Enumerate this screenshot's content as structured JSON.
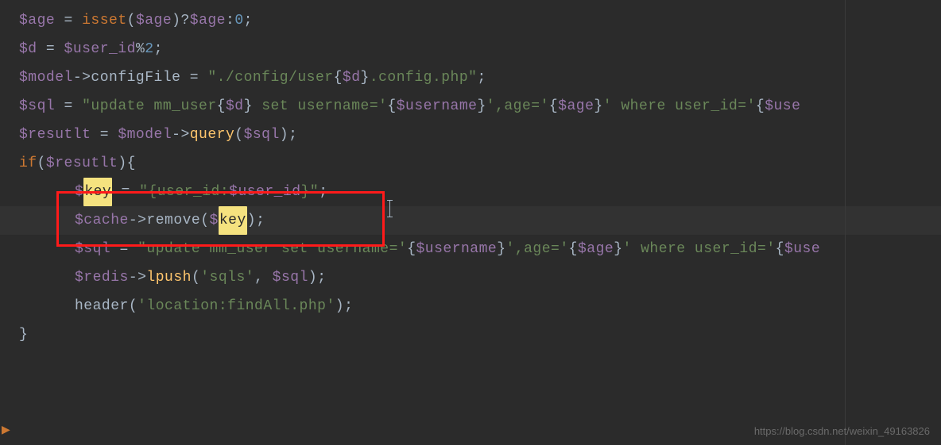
{
  "code": {
    "l1": {
      "v1": "$age",
      "eq": " = ",
      "kw": "isset",
      "p1": "(",
      "v2": "$age",
      "p2": ")?",
      "v3": "$age",
      "p3": ":",
      "n": "0",
      "end": ";"
    },
    "l2": {
      "v1": "$d",
      "eq": " = ",
      "v2": "$user_id",
      "op": "%",
      "n": "2",
      "end": ";"
    },
    "l3": {
      "v1": "$model",
      "arrow": "->",
      "prop": "configFile",
      "eq": " = ",
      "s1": "\"./config/user",
      "b1": "{",
      "v2": "$d",
      "b2": "}",
      "s2": ".config.php\"",
      "end": ";"
    },
    "l4": {
      "v1": "$sql",
      "eq": " = ",
      "s1": "\"update mm_user",
      "b1": "{",
      "v2": "$d",
      "b2": "}",
      "s2": " set username='",
      "b3": "{",
      "v3": "$username",
      "b4": "}",
      "s3": "',age='",
      "b5": "{",
      "v4": "$age",
      "b6": "}",
      "s4": "' where user_id='",
      "b7": "{",
      "v5": "$use"
    },
    "l5": {
      "v1": "$resutlt",
      "eq": " = ",
      "v2": "$model",
      "arrow": "->",
      "fn": "query",
      "p1": "(",
      "v3": "$sql",
      "p2": ")",
      "end": ";"
    },
    "l6": {
      "kw": "if",
      "p1": "(",
      "v1": "$resutlt",
      "p2": "){"
    },
    "l7": {
      "dol": "$",
      "hl": "key",
      "eq": " = ",
      "s1": "\"{user_id:",
      "v1": "$user_id",
      "s2": "}\"",
      "end": ";"
    },
    "l8": {
      "v1": "$cache",
      "arrow": "->",
      "fn": "remove",
      "p1": "(",
      "dol": "$",
      "hl": "key",
      "p2": ")",
      "end": ";"
    },
    "l9": {
      "v1": "$sql",
      "eq": " = ",
      "s1": "\"update mm_user set username='",
      "b1": "{",
      "v2": "$username",
      "b2": "}",
      "s2": "',age='",
      "b3": "{",
      "v3": "$age",
      "b4": "}",
      "s3": "' where user_id='",
      "b5": "{",
      "v4": "$use"
    },
    "l10": {
      "v1": "$redis",
      "arrow": "->",
      "fn": "lpush",
      "p1": "(",
      "s1": "'sqls'",
      "c": ", ",
      "v2": "$sql",
      "p2": ")",
      "end": ";"
    },
    "l11": {
      "fn": "header",
      "p1": "(",
      "s1": "'location:findAll.php'",
      "p2": ")",
      "end": ";"
    },
    "l12": {
      "brace": "}"
    }
  },
  "watermark": "https://blog.csdn.net/weixin_49163826",
  "chevron": "▶"
}
